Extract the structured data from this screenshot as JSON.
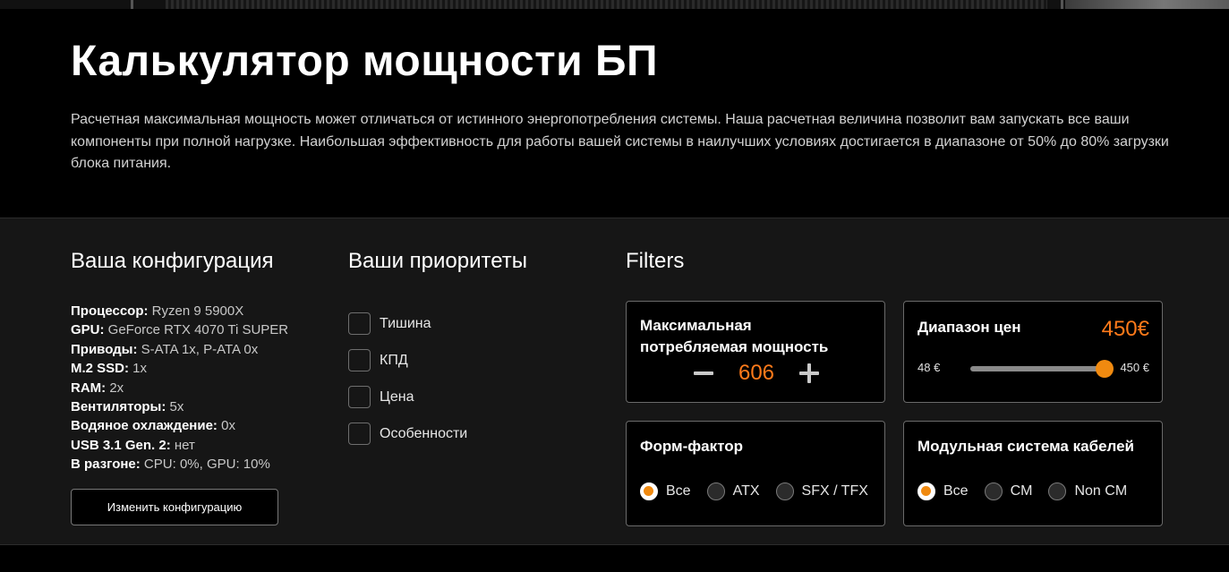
{
  "header": {
    "title": "Калькулятор мощности БП",
    "description": "Расчетная максимальная мощность может отличаться от истинного энергопотребления системы. Наша расчетная величина позволит вам запускать все ваши компоненты при полной нагрузке. Наибольшая эффективность для работы вашей системы в наилучших условиях достигается в диапазоне от 50% до 80% загрузки блока питания."
  },
  "configuration": {
    "title": "Ваша конфигурация",
    "specs": [
      {
        "label": "Процессор:",
        "value": " Ryzen 9 5900X"
      },
      {
        "label": "GPU:",
        "value": " GeForce RTX 4070 Ti SUPER"
      },
      {
        "label": "Приводы:",
        "value": " S-ATA 1x, P-ATA 0x"
      },
      {
        "label": "M.2 SSD:",
        "value": " 1x"
      },
      {
        "label": "RAM:",
        "value": " 2x"
      },
      {
        "label": "Вентиляторы:",
        "value": " 5x"
      },
      {
        "label": "Водяное охлаждение:",
        "value": " 0x"
      },
      {
        "label": "USB 3.1 Gen. 2:",
        "value": " нет"
      },
      {
        "label": "В разгоне:",
        "value": " CPU: 0%, GPU: 10%"
      }
    ],
    "change_button": "Изменить конфигурацию"
  },
  "priorities": {
    "title": "Ваши приоритеты",
    "items": [
      {
        "label": "Тишина",
        "checked": false
      },
      {
        "label": "КПД",
        "checked": false
      },
      {
        "label": "Цена",
        "checked": false
      },
      {
        "label": "Особенности",
        "checked": false
      }
    ]
  },
  "filters": {
    "title": "Filters",
    "max_power": {
      "title": "Максимальная потребляемая мощность",
      "value": "606"
    },
    "price_range": {
      "title": "Диапазон цен",
      "current": "450€",
      "min_label": "48 €",
      "max_label": "450 €",
      "slider_fraction": 1.0
    },
    "form_factor": {
      "title": "Форм-фактор",
      "options": [
        "Все",
        "ATX",
        "SFX / TFX"
      ],
      "selected": "Все"
    },
    "modular": {
      "title": "Модульная система кабелей",
      "options": [
        "Все",
        "CM",
        "Non CM"
      ],
      "selected": "Все"
    }
  },
  "colors": {
    "accent": "#ff7a1a",
    "radio_checked": "#f08a10"
  }
}
